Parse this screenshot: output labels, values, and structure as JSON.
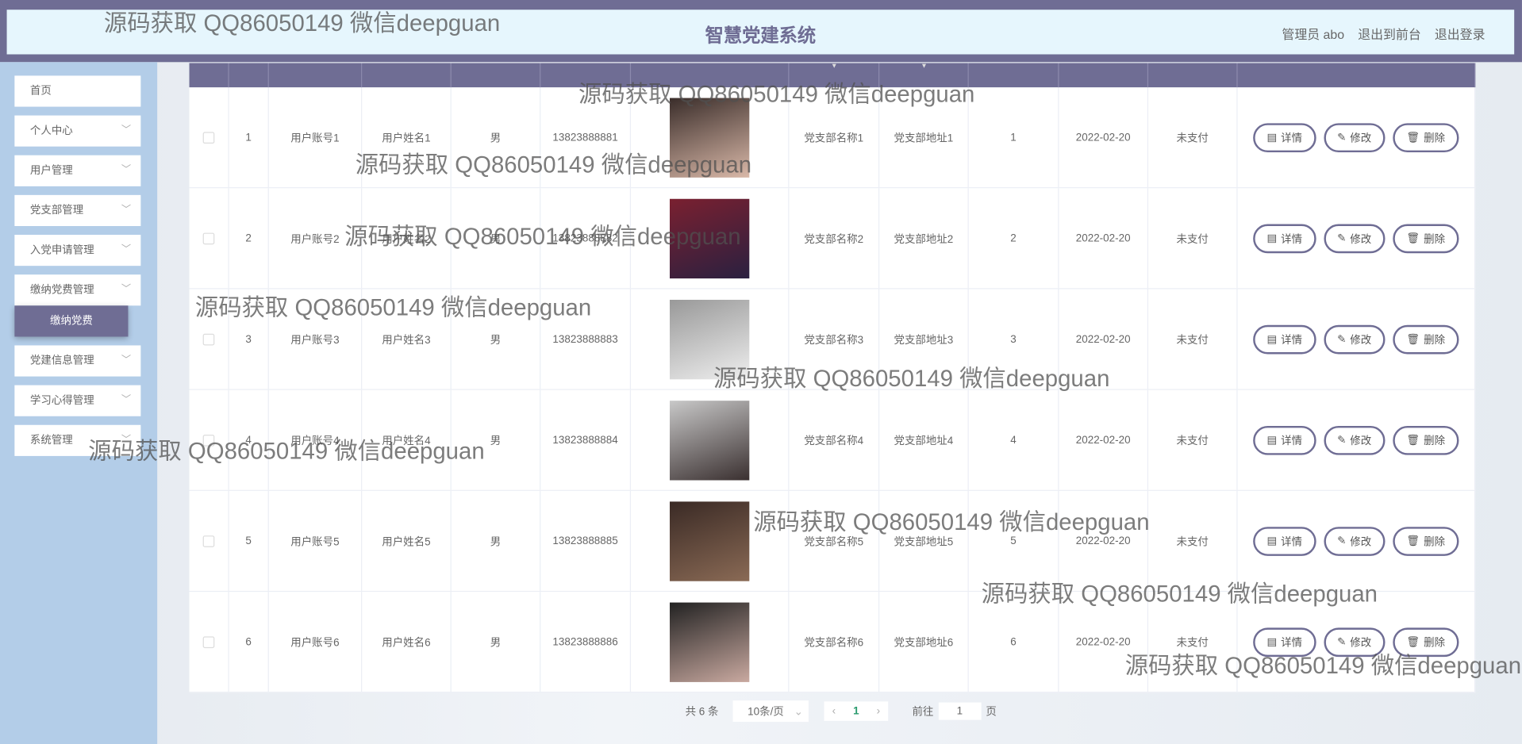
{
  "header": {
    "title": "智慧党建系统",
    "user": "管理员 abo",
    "front": "退出到前台",
    "logout": "退出登录"
  },
  "sidebar": {
    "items": [
      {
        "label": "首页",
        "chev": false
      },
      {
        "label": "个人中心",
        "chev": true
      },
      {
        "label": "用户管理",
        "chev": true
      },
      {
        "label": "党支部管理",
        "chev": true
      },
      {
        "label": "入党申请管理",
        "chev": true
      },
      {
        "label": "缴纳党费管理",
        "chev": true
      },
      {
        "label": "党建信息管理",
        "chev": true
      },
      {
        "label": "学习心得管理",
        "chev": true
      },
      {
        "label": "系统管理",
        "chev": true
      }
    ],
    "submenu": "缴纳党费"
  },
  "table": {
    "rows": [
      {
        "index": "1",
        "account": "用户账号1",
        "name": "用户姓名1",
        "gender": "男",
        "phone": "13823888881",
        "branch": "党支部名称1",
        "address": "党支部地址1",
        "amount": "1",
        "date": "2022-02-20",
        "status": "未支付"
      },
      {
        "index": "2",
        "account": "用户账号2",
        "name": "用户姓名2",
        "gender": "男",
        "phone": "13823888882",
        "branch": "党支部名称2",
        "address": "党支部地址2",
        "amount": "2",
        "date": "2022-02-20",
        "status": "未支付"
      },
      {
        "index": "3",
        "account": "用户账号3",
        "name": "用户姓名3",
        "gender": "男",
        "phone": "13823888883",
        "branch": "党支部名称3",
        "address": "党支部地址3",
        "amount": "3",
        "date": "2022-02-20",
        "status": "未支付"
      },
      {
        "index": "4",
        "account": "用户账号4",
        "name": "用户姓名4",
        "gender": "男",
        "phone": "13823888884",
        "branch": "党支部名称4",
        "address": "党支部地址4",
        "amount": "4",
        "date": "2022-02-20",
        "status": "未支付"
      },
      {
        "index": "5",
        "account": "用户账号5",
        "name": "用户姓名5",
        "gender": "男",
        "phone": "13823888885",
        "branch": "党支部名称5",
        "address": "党支部地址5",
        "amount": "5",
        "date": "2022-02-20",
        "status": "未支付"
      },
      {
        "index": "6",
        "account": "用户账号6",
        "name": "用户姓名6",
        "gender": "男",
        "phone": "13823888886",
        "branch": "党支部名称6",
        "address": "党支部地址6",
        "amount": "6",
        "date": "2022-02-20",
        "status": "未支付"
      }
    ],
    "actions": {
      "detail": "详情",
      "edit": "修改",
      "delete": "删除"
    }
  },
  "pagination": {
    "total": "共 6 条",
    "page_size": "10条/页",
    "current": "1",
    "goto": "前往",
    "goto_value": "1",
    "page_suffix": "页"
  },
  "watermark": "源码获取 QQ86050149 微信deepguan",
  "colors": {
    "primary": "#6f6d94",
    "header_bg": "#e6f6fd",
    "sidebar_bg": "#b3cde8"
  }
}
